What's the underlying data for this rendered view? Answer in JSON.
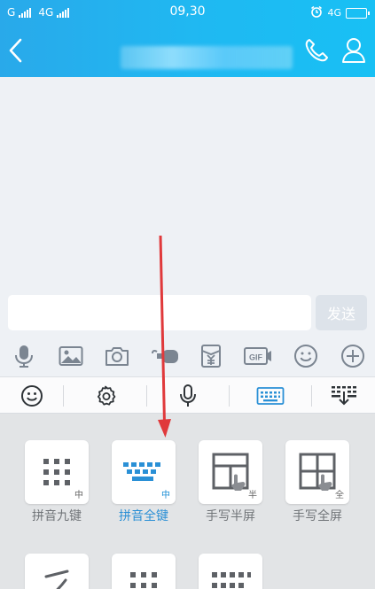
{
  "status_bar": {
    "carrier1": "G",
    "carrier2": "4G",
    "time": "09,30",
    "network_right": "4G"
  },
  "header": {
    "contact_name": ""
  },
  "input": {
    "placeholder": "",
    "send_label": "发送"
  },
  "func_icons": [
    "mic-icon",
    "image-icon",
    "camera-icon",
    "red-packet-icon",
    "redpacket-money-icon",
    "gif-icon",
    "emoji-icon",
    "plus-icon"
  ],
  "ime_bar_icons": [
    "emoji-icon",
    "settings-icon",
    "mic-icon",
    "keyboard-icon",
    "collapse-keyboard-icon"
  ],
  "keyboards": [
    {
      "label": "拼音九键",
      "tag": "中",
      "selected": false
    },
    {
      "label": "拼音全键",
      "tag": "中",
      "selected": true
    },
    {
      "label": "手写半屏",
      "tag": "半",
      "selected": false
    },
    {
      "label": "手写全屏",
      "tag": "全",
      "selected": false
    }
  ],
  "colors": {
    "header_accent": "#1fb9f2",
    "selected_text": "#2a8fd5",
    "arrow": "#e0393b"
  }
}
